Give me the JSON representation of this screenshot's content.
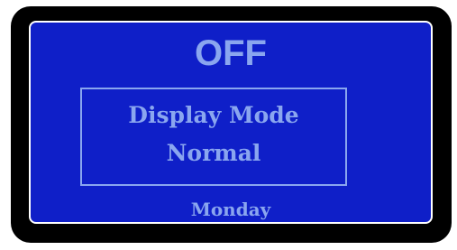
{
  "display": {
    "status": "OFF",
    "mode_label": "Display Mode",
    "mode_value": "Normal",
    "day": "Monday"
  },
  "colors": {
    "bezel": "#000000",
    "screen_background": "#0f1fc8",
    "text": "#8aa6ef",
    "screen_border": "#ffffff"
  }
}
